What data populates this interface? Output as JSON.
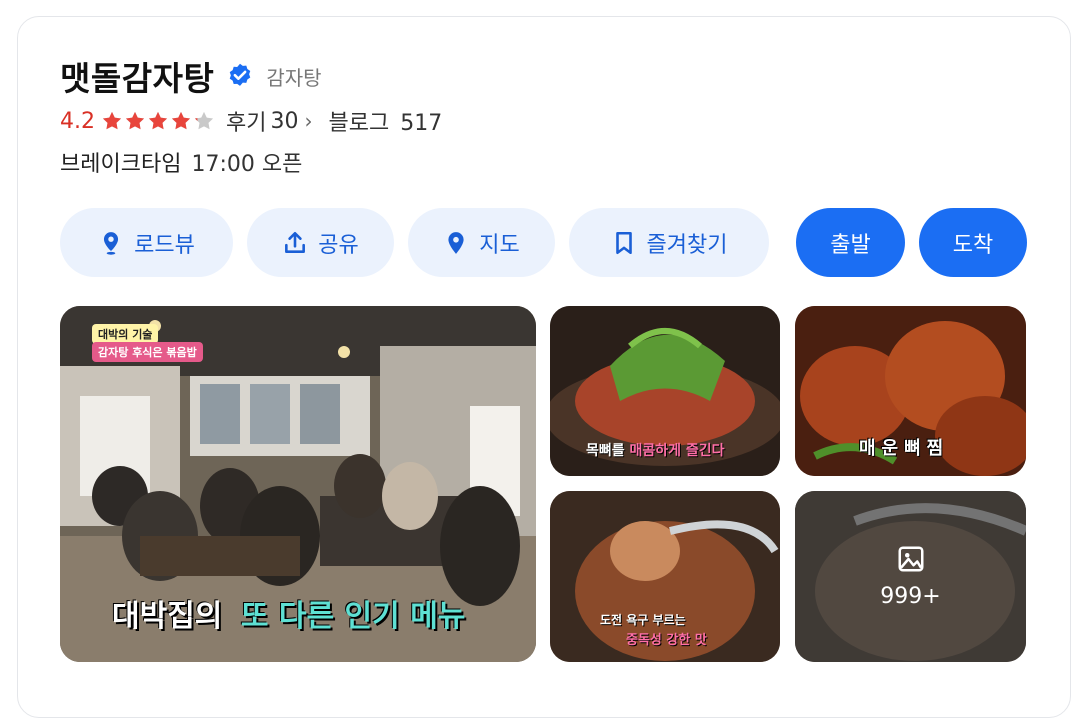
{
  "place": {
    "name": "맷돌감자탕",
    "category": "감자탕",
    "rating": "4.2",
    "stars_filled": 4.2,
    "stars_total": 5,
    "reviews_label": "후기",
    "reviews_count": "30",
    "blog_label": "블로그",
    "blog_count": "517",
    "hours_status": "브레이크타임",
    "hours_detail": "17:00 오픈"
  },
  "actions": {
    "roadview": "로드뷰",
    "share": "공유",
    "map": "지도",
    "bookmark": "즐겨찾기",
    "depart": "출발",
    "arrive": "도착"
  },
  "photos": {
    "main_tag": "대박의 기술",
    "main_sub": "감자탕 후식은 볶음밥",
    "main_caption_a": "대박집의",
    "main_caption_b": "또 다른 인기 메뉴",
    "p1_caption_a": "목뼈를",
    "p1_caption_b": "매콤하게 즐긴다",
    "p2_caption": "매운뼈찜",
    "p3_caption_a": "도전 욕구 부르는",
    "p3_caption_b": "중독성 강한 맛",
    "more_count": "999+"
  },
  "colors": {
    "accent_blue": "#1b6ef3",
    "light_blue": "#ebf2fd",
    "rating_red": "#d93025",
    "star_red": "#e8453c",
    "star_gray": "#c9c9c9"
  }
}
